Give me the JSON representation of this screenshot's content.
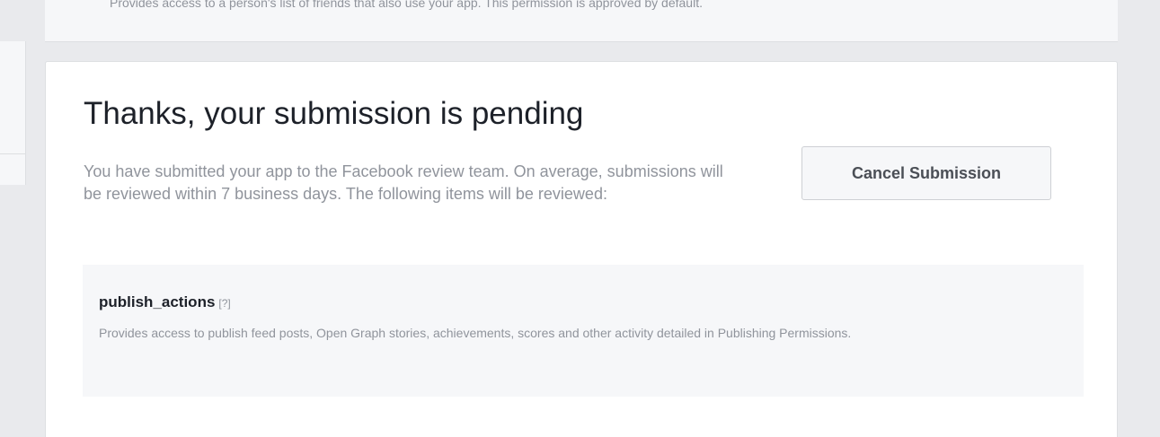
{
  "top_card": {
    "text": "Provides access to a person's list of friends that also use your app. This permission is approved by default."
  },
  "submission": {
    "heading": "Thanks, your submission is pending",
    "description": "You have submitted your app to the Facebook review team. On average, submissions will be reviewed within 7 business days. The following items will be reviewed:",
    "cancel_label": "Cancel Submission"
  },
  "permissions": [
    {
      "name": "publish_actions",
      "help_label": "[?]",
      "description": "Provides access to publish feed posts, Open Graph stories, achievements, scores and other activity detailed in Publishing Permissions."
    }
  ]
}
